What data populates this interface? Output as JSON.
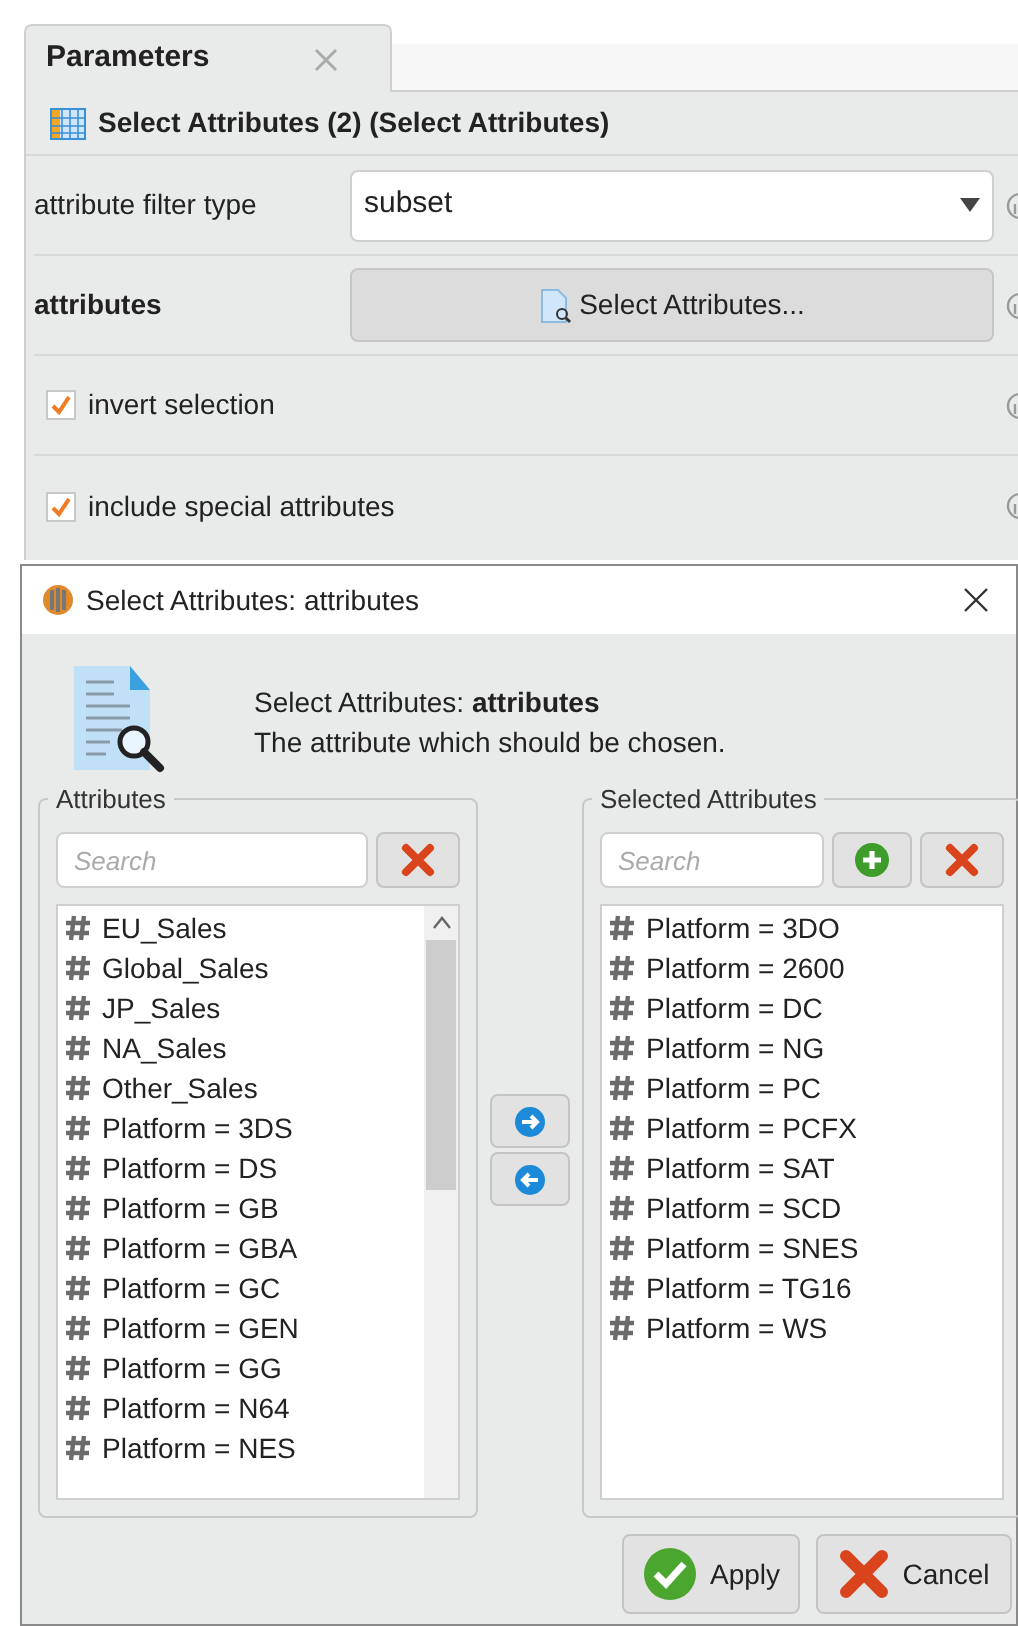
{
  "panel_tab": {
    "label": "Parameters",
    "selected": true
  },
  "operator_header": "Select Attributes (2) (Select Attributes)",
  "parameters": [
    {
      "kind": "dropdown",
      "label": "attribute filter type",
      "value": "subset"
    },
    {
      "kind": "button",
      "label": "attributes",
      "button": "Select Attributes..."
    },
    {
      "kind": "checkbox",
      "label": "invert selection",
      "checked": true
    },
    {
      "kind": "checkbox",
      "label": "include special attributes",
      "checked": true
    }
  ],
  "dialog": {
    "title": "Select Attributes: attributes",
    "heading": "Select Attributes: **attributes**",
    "description": "The attribute which should be chosen.",
    "available": {
      "title": "Attributes",
      "search_placeholder": "Search",
      "items": [
        "EU_Sales",
        "Global_Sales",
        "JP_Sales",
        "NA_Sales",
        "Other_Sales",
        "Platform = 3DS",
        "Platform = DS",
        "Platform = GB",
        "Platform = GBA",
        "Platform = GC",
        "Platform = GEN",
        "Platform = GG",
        "Platform = N64",
        "Platform = NES"
      ]
    },
    "selected": {
      "title": "Selected Attributes",
      "search_placeholder": "Search",
      "items": [
        "Platform = 3DO",
        "Platform = 2600",
        "Platform = DC",
        "Platform = NG",
        "Platform = PC",
        "Platform = PCFX",
        "Platform = SAT",
        "Platform = SCD",
        "Platform = SNES",
        "Platform = TG16",
        "Platform = WS"
      ]
    },
    "buttons": [
      {
        "kind": "apply",
        "label": "Apply"
      },
      {
        "kind": "cancel",
        "label": "Cancel"
      }
    ]
  }
}
